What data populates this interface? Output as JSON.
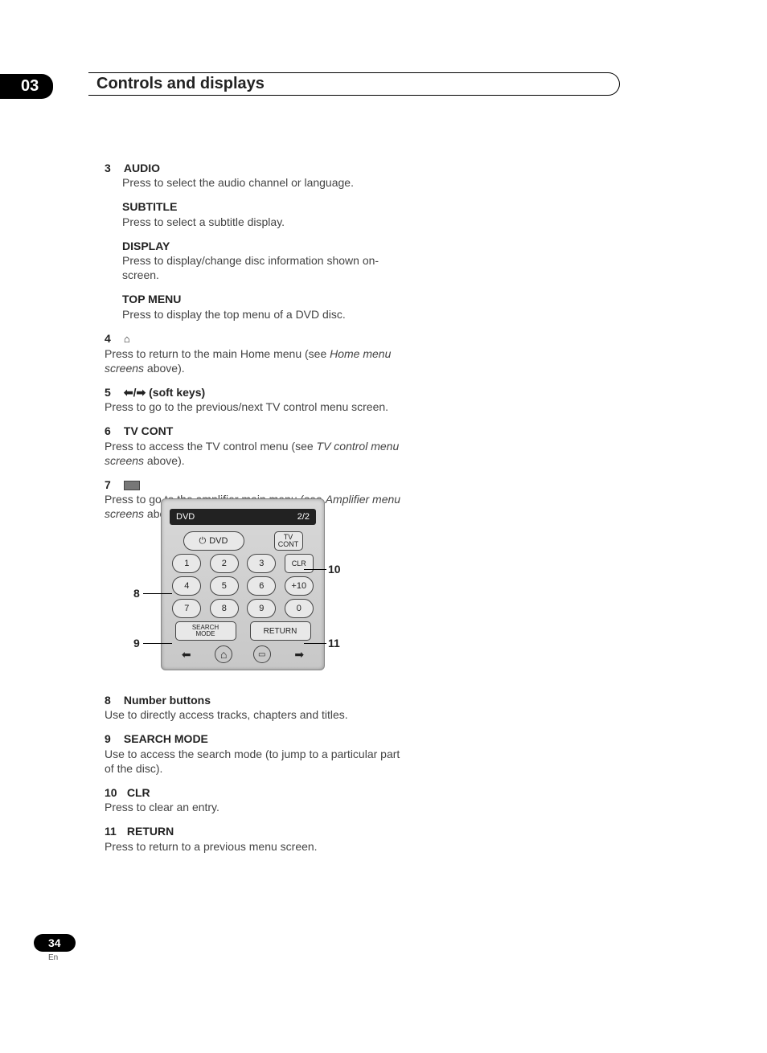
{
  "chapter": {
    "number": "03",
    "title": "Controls and displays"
  },
  "items": {
    "n3": "3",
    "audio_label": "AUDIO",
    "audio_desc": "Press to select the audio channel or language.",
    "subtitle_label": "SUBTITLE",
    "subtitle_desc": "Press to select a subtitle display.",
    "display_label": "DISPLAY",
    "display_desc": "Press to display/change disc information shown on-screen.",
    "topmenu_label": "TOP MENU",
    "topmenu_desc": "Press to display the top menu of a DVD disc.",
    "n4": "4",
    "home_desc1": "Press to return to the main Home menu (see ",
    "home_ref": "Home menu screens",
    "home_desc2": " above).",
    "n5": "5",
    "softkeys_arrows": "⬅/➡",
    "softkeys_label": "(soft keys)",
    "softkeys_desc": "Press to go to the previous/next TV control menu screen.",
    "n6": "6",
    "tvcont_label": "TV CONT",
    "tvcont_desc1": "Press to access the TV control menu (see ",
    "tvcont_ref": "TV control menu screens",
    "tvcont_desc2": " above).",
    "n7": "7",
    "amp_desc1": "Press to go to the amplifier main menu (see ",
    "amp_ref": "Amplifier menu screens",
    "amp_desc2": " above).",
    "n8": "8",
    "numbuttons_label": "Number buttons",
    "numbuttons_desc": "Use to directly access tracks, chapters and titles.",
    "n9": "9",
    "search_label": "SEARCH MODE",
    "search_desc": "Use to access the search mode (to jump to a particular part of the disc).",
    "n10": "10",
    "clr_label": "CLR",
    "clr_desc": "Press to clear an entry.",
    "n11": "11",
    "return_label": "RETURN",
    "return_desc": "Press to return to a previous menu screen."
  },
  "remote": {
    "screen_left": "DVD",
    "screen_right": "2/2",
    "dvd": "DVD",
    "tvcont1": "TV",
    "tvcont2": "CONT",
    "b1": "1",
    "b2": "2",
    "b3": "3",
    "clr": "CLR",
    "b4": "4",
    "b5": "5",
    "b6": "6",
    "p10": "+10",
    "b7": "7",
    "b8": "8",
    "b9": "9",
    "b0": "0",
    "search1": "SEARCH",
    "search2": "MODE",
    "return": "RETURN",
    "left": "⬅",
    "home": "⌂",
    "menu": "▭",
    "right": "➡"
  },
  "callouts": {
    "c8": "8",
    "c9": "9",
    "c10": "10",
    "c11": "11"
  },
  "footer": {
    "page": "34",
    "lang": "En"
  }
}
